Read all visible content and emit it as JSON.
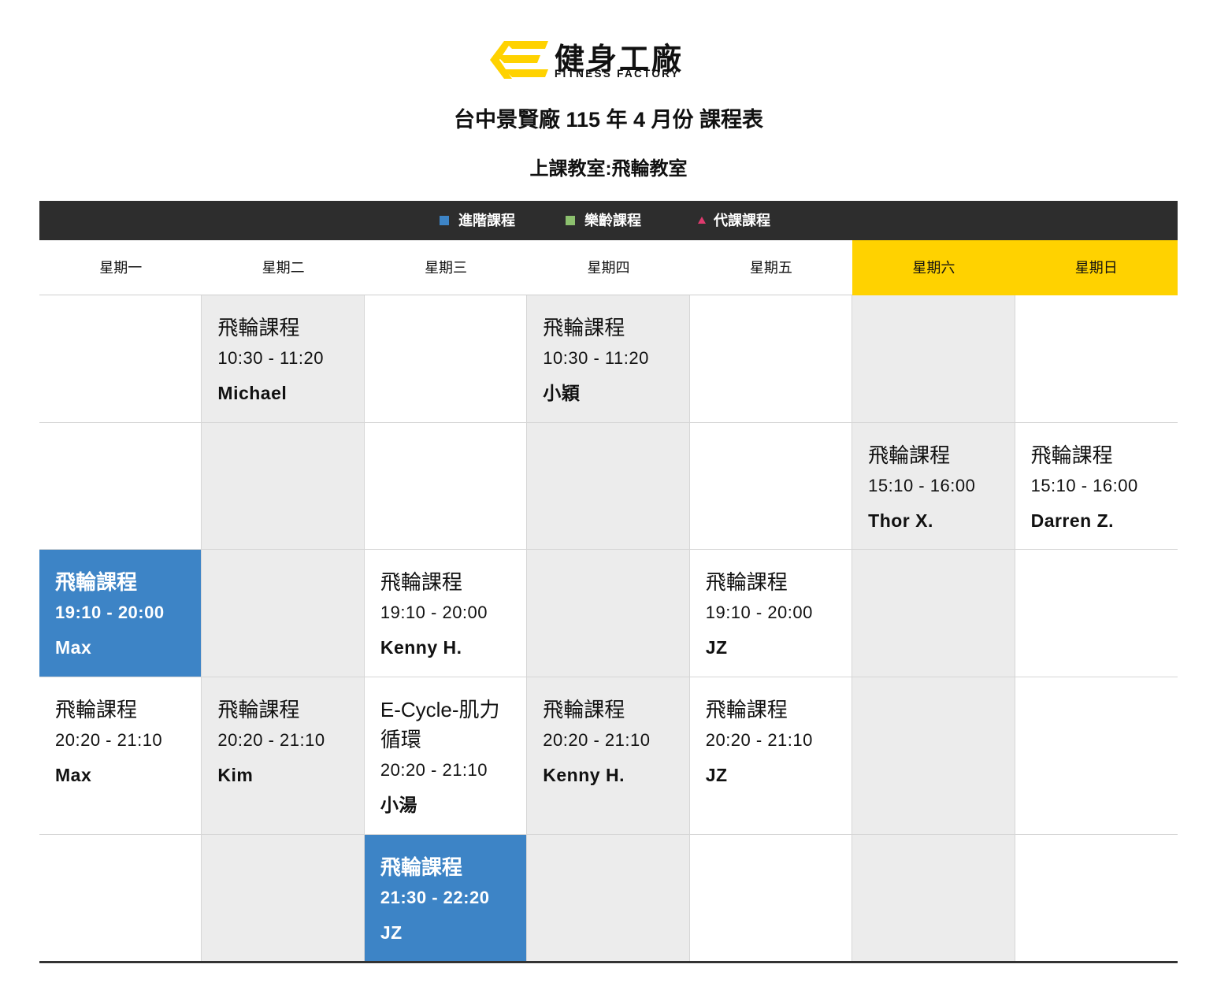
{
  "brand": {
    "name_cn": "健身工廠",
    "name_en": "FITNESS FACTORY",
    "colors": {
      "yellow": "#ffd200",
      "dark": "#2d2d2d",
      "blue": "#3d84c6",
      "green": "#8cc06e",
      "pink": "#e03a6e",
      "gray_column": "#ececec"
    }
  },
  "page": {
    "title": "台中景賢廠 115 年 4 月份 課程表",
    "subtitle": "上課教室:飛輪教室"
  },
  "legend": [
    {
      "label": "進階課程",
      "marker": "square",
      "color": "#3d84c6"
    },
    {
      "label": "樂齡課程",
      "marker": "square",
      "color": "#8cc06e"
    },
    {
      "label": "代課課程",
      "marker": "triangle",
      "color": "#e03a6e"
    }
  ],
  "days": [
    "星期一",
    "星期二",
    "星期三",
    "星期四",
    "星期五",
    "星期六",
    "星期日"
  ],
  "weekend_days": [
    5,
    6
  ],
  "schedule": [
    {
      "day": 1,
      "row": 0,
      "name": "飛輪課程",
      "time": "10:30 - 11:20",
      "coach": "Michael",
      "advanced": false
    },
    {
      "day": 3,
      "row": 0,
      "name": "飛輪課程",
      "time": "10:30 - 11:20",
      "coach": "小穎",
      "advanced": false
    },
    {
      "day": 5,
      "row": 1,
      "name": "飛輪課程",
      "time": "15:10 - 16:00",
      "coach": "Thor X.",
      "advanced": false
    },
    {
      "day": 6,
      "row": 1,
      "name": "飛輪課程",
      "time": "15:10 - 16:00",
      "coach": "Darren Z.",
      "advanced": false
    },
    {
      "day": 0,
      "row": 2,
      "name": "飛輪課程",
      "time": "19:10 - 20:00",
      "coach": "Max",
      "advanced": true
    },
    {
      "day": 2,
      "row": 2,
      "name": "飛輪課程",
      "time": "19:10 - 20:00",
      "coach": "Kenny H.",
      "advanced": false
    },
    {
      "day": 4,
      "row": 2,
      "name": "飛輪課程",
      "time": "19:10 - 20:00",
      "coach": "JZ",
      "advanced": false
    },
    {
      "day": 0,
      "row": 3,
      "name": "飛輪課程",
      "time": "20:20 - 21:10",
      "coach": "Max",
      "advanced": false
    },
    {
      "day": 1,
      "row": 3,
      "name": "飛輪課程",
      "time": "20:20 - 21:10",
      "coach": "Kim",
      "advanced": false
    },
    {
      "day": 2,
      "row": 3,
      "name": "E-Cycle-肌力循環",
      "time": "20:20 - 21:10",
      "coach": "小湯",
      "advanced": false
    },
    {
      "day": 3,
      "row": 3,
      "name": "飛輪課程",
      "time": "20:20 - 21:10",
      "coach": "Kenny H.",
      "advanced": false
    },
    {
      "day": 4,
      "row": 3,
      "name": "飛輪課程",
      "time": "20:20 - 21:10",
      "coach": "JZ",
      "advanced": false
    },
    {
      "day": 2,
      "row": 4,
      "name": "飛輪課程",
      "time": "21:30 - 22:20",
      "coach": "JZ",
      "advanced": true
    }
  ]
}
